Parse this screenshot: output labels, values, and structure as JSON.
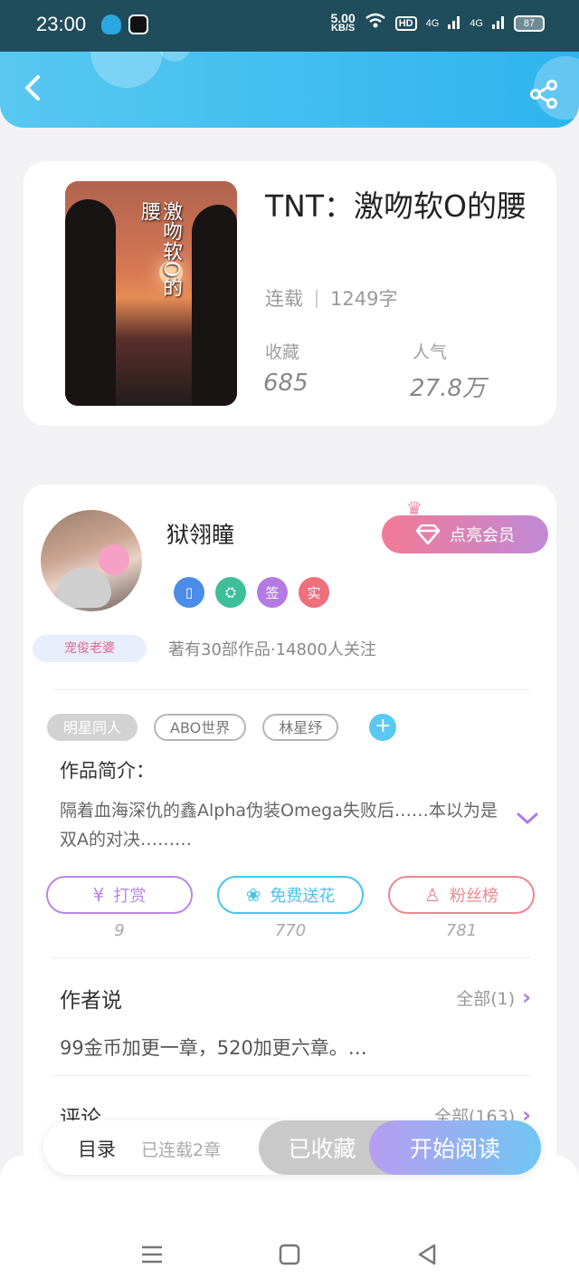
{
  "status_bar": {
    "time": "23:00",
    "speed_value": "5.00",
    "speed_unit": "KB/S",
    "hd_label": "HD",
    "net1": "4G",
    "net2": "4G",
    "battery": "87"
  },
  "header": {
    "back_icon": "chevron-left-icon",
    "share_icon": "share-icon"
  },
  "book": {
    "cover_title": "激吻软O的腰",
    "title": "TNT：激吻软O的腰",
    "status": "连载",
    "word_count": "1249字",
    "favorites_label": "收藏",
    "favorites_value": "685",
    "popularity_label": "人气",
    "popularity_value": "27.8万"
  },
  "author": {
    "name": "狱翎瞳",
    "fan_badge": "宠俊老婆",
    "vip_button": "点亮会员",
    "badges": [
      {
        "icon": "phone-icon",
        "text": "▯",
        "color": "#4a8ce8"
      },
      {
        "icon": "handshake-icon",
        "text": "⛭",
        "color": "#3dbf9a"
      },
      {
        "icon": "sign-icon",
        "text": "签",
        "color": "#b47ae3"
      },
      {
        "icon": "verified-icon",
        "text": "实",
        "color": "#ef6f7c"
      }
    ],
    "meta": "著有30部作品·14800人关注"
  },
  "tags": [
    "明星同人",
    "ABO世界",
    "林星纾"
  ],
  "intro": {
    "heading": "作品简介：",
    "text": "隔着血海深仇的鑫Alpha伪装Omega失败后……本以为是双A的对决………"
  },
  "actions": [
    {
      "label": "打赏",
      "icon": "coin-icon",
      "glyph": "¥",
      "count": "9",
      "color": "#b986e6"
    },
    {
      "label": "免费送花",
      "icon": "flower-icon",
      "glyph": "❀",
      "count": "770",
      "color": "#46c4ec"
    },
    {
      "label": "粉丝榜",
      "icon": "fan-icon",
      "glyph": "♙",
      "count": "781",
      "color": "#ee8790"
    }
  ],
  "author_says": {
    "title": "作者说",
    "link": "全部(1)",
    "content": "99金币加更一章，520加更六章。…"
  },
  "comments": {
    "title": "评论",
    "link": "全部(163)"
  },
  "bottom": {
    "catalog": "目录",
    "updated": "已连载2章",
    "collected": "已收藏",
    "start_reading": "开始阅读"
  }
}
